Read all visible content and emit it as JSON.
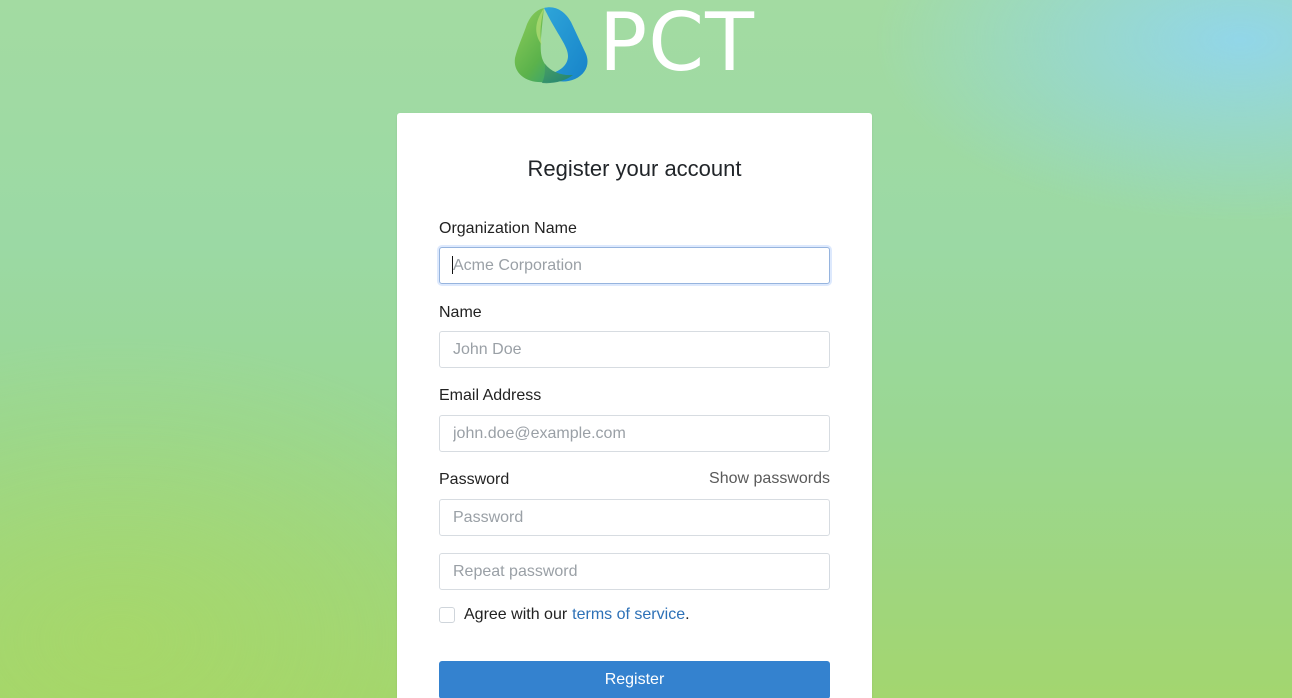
{
  "brand": {
    "name": "PCT",
    "icon": "triangle-logo-icon",
    "colors": {
      "green": "#79b83d",
      "teal": "#27a08a",
      "blue": "#2aa0d8"
    }
  },
  "form": {
    "title": "Register your account",
    "organization": {
      "label": "Organization Name",
      "placeholder": "Acme Corporation",
      "value": ""
    },
    "name": {
      "label": "Name",
      "placeholder": "John Doe",
      "value": ""
    },
    "email": {
      "label": "Email Address",
      "placeholder": "john.doe@example.com",
      "value": ""
    },
    "password": {
      "label": "Password",
      "show_label": "Show passwords",
      "placeholder": "Password",
      "repeat_placeholder": "Repeat password",
      "value": "",
      "repeat_value": ""
    },
    "terms": {
      "prefix": "Agree with our",
      "link": "terms of service",
      "suffix": ".",
      "checked": false
    },
    "submit_label": "Register"
  },
  "colors": {
    "primary_button": "#3482cf",
    "link": "#2d71b7",
    "card_background": "#ffffff"
  }
}
